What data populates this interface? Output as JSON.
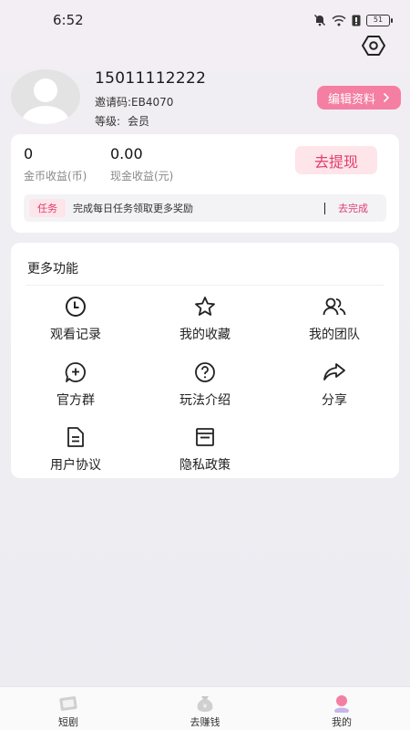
{
  "status_bar": {
    "time": "6:52",
    "battery": "51"
  },
  "profile": {
    "phone": "15011112222",
    "invite_code": "邀请码:EB4070",
    "level_label": "等级:",
    "level_value": "会员",
    "edit_button": "编辑资料"
  },
  "earnings": {
    "coin_value": "0",
    "coin_label": "金币收益(币)",
    "cash_value": "0.00",
    "cash_label": "现金收益(元)",
    "withdraw_button": "去提现"
  },
  "task": {
    "tag": "任务",
    "text": "完成每日任务领取更多奖励",
    "action": "去完成"
  },
  "features": {
    "title": "更多功能",
    "items": [
      {
        "label": "观看记录",
        "icon": "clock-icon"
      },
      {
        "label": "我的收藏",
        "icon": "star-icon"
      },
      {
        "label": "我的团队",
        "icon": "team-icon"
      },
      {
        "label": "官方群",
        "icon": "chat-add-icon"
      },
      {
        "label": "玩法介绍",
        "icon": "help-icon"
      },
      {
        "label": "分享",
        "icon": "share-icon"
      },
      {
        "label": "用户协议",
        "icon": "document-icon"
      },
      {
        "label": "隐私政策",
        "icon": "policy-icon"
      }
    ]
  },
  "tabbar": {
    "items": [
      {
        "label": "短剧",
        "icon": "drama-icon"
      },
      {
        "label": "去赚钱",
        "icon": "money-bag-icon"
      },
      {
        "label": "我的",
        "icon": "profile-icon",
        "active": true
      }
    ],
    "active_color": "#f47fa3"
  },
  "colors": {
    "accent": "#f47fa3",
    "accent_text": "#e23c6e",
    "accent_bg": "#fde5ea"
  }
}
